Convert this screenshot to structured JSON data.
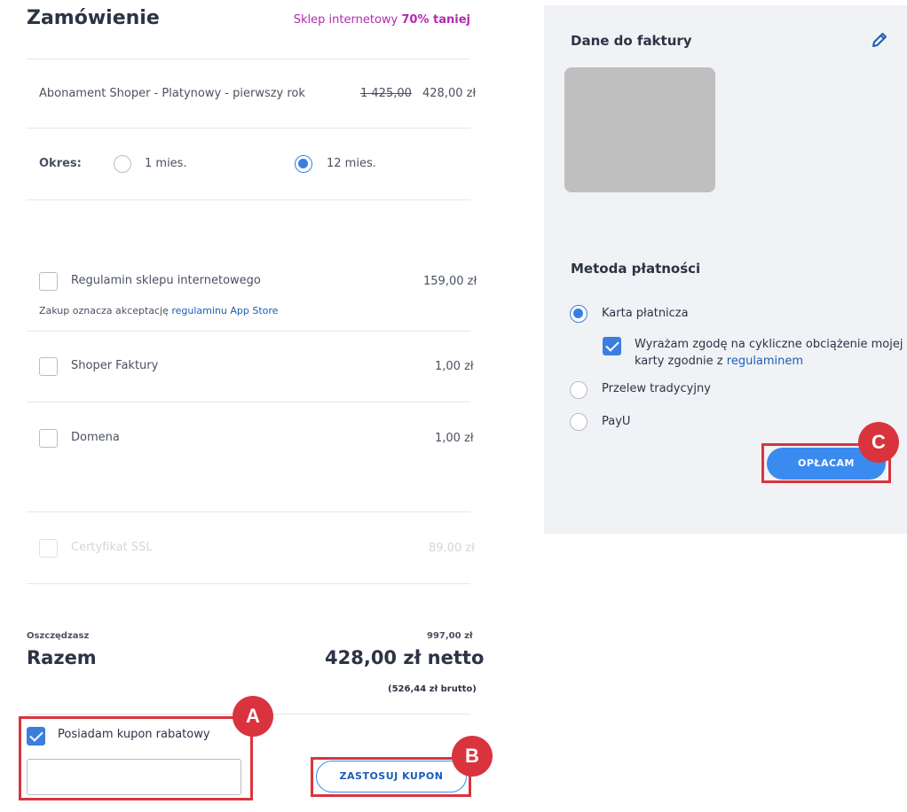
{
  "order": {
    "title": "Zamówienie",
    "promo_prefix": "Sklep internetowy ",
    "promo_bold": "70% taniej",
    "subscription": {
      "name": "Abonament Shoper - Platynowy - pierwszy rok",
      "old_price": "1 425,00",
      "price": "428,00 zł"
    },
    "period": {
      "label": "Okres:",
      "options": [
        {
          "label": "1 mies.",
          "selected": false
        },
        {
          "label": "12 mies.",
          "selected": true
        }
      ]
    },
    "addons": [
      {
        "label": "Regulamin sklepu internetowego",
        "price": "159,00 zł",
        "checked": false
      },
      {
        "label": "Shoper Faktury",
        "price": "1,00 zł",
        "checked": false
      },
      {
        "label": "Domena",
        "price": "1,00 zł",
        "checked": false
      },
      {
        "label": "Certyfikat SSL",
        "price": "89,00 zł",
        "checked": false
      }
    ],
    "appstore_note_prefix": "Zakup oznacza akceptację ",
    "appstore_note_link": "regulaminu App Store",
    "savings_label": "Oszczędzasz",
    "savings_value": "997,00 zł",
    "total_label": "Razem",
    "total_net": "428,00 zł netto",
    "total_gross": "(526,44 zł brutto)",
    "coupon": {
      "checkbox_label": "Posiadam kupon rabatowy",
      "checked": true,
      "input_value": "",
      "apply_button": "ZASTOSUJ KUPON"
    }
  },
  "invoice": {
    "title": "Dane do faktury"
  },
  "payment": {
    "title": "Metoda płatności",
    "methods": [
      {
        "label": "Karta płatnicza",
        "selected": true
      },
      {
        "label": "Przelew tradycyjny",
        "selected": false
      },
      {
        "label": "PayU",
        "selected": false
      }
    ],
    "consent_text": "Wyrażam zgodę na cykliczne obciążenie mojej",
    "consent_text2_prefix": "karty zgodnie z ",
    "consent_link": "regulaminem",
    "consent_checked": true,
    "pay_button": "OPŁACAM"
  },
  "callouts": {
    "a": "A",
    "b": "B",
    "c": "C"
  },
  "colors": {
    "accent": "#3a8bf0",
    "callout": "#d9343d",
    "promo": "#b32bb0"
  }
}
